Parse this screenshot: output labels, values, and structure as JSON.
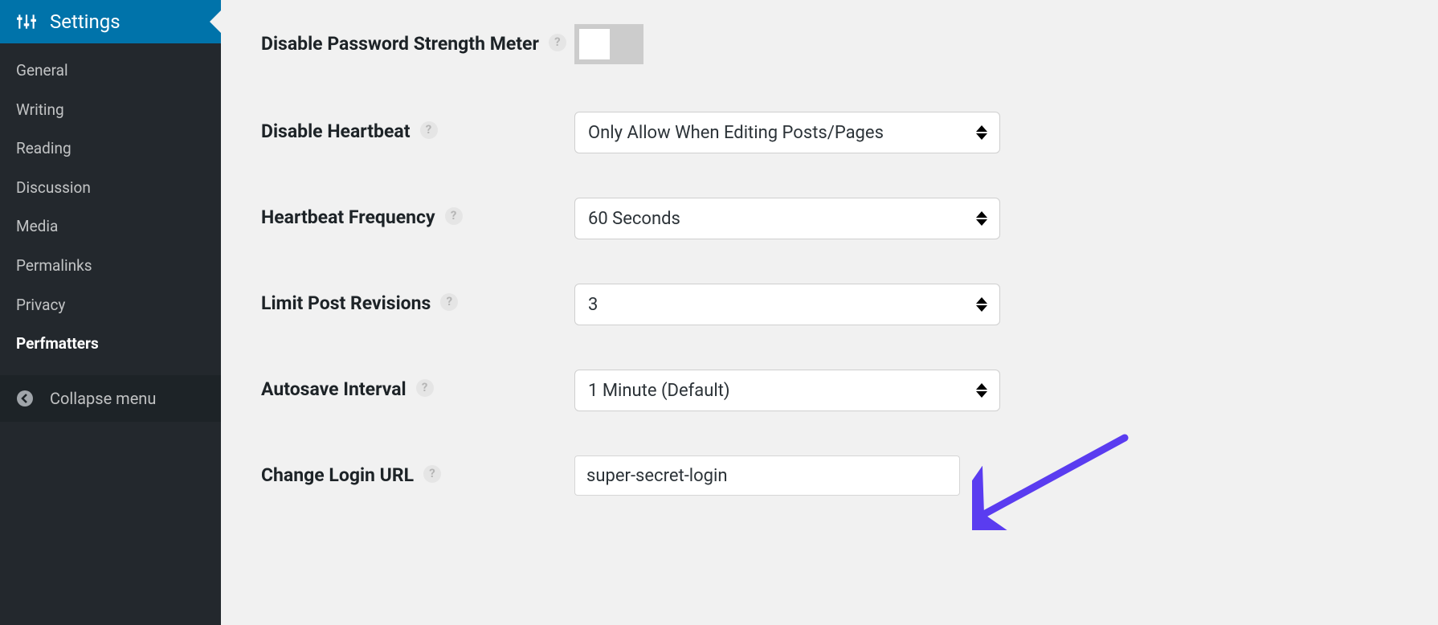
{
  "sidebar": {
    "header": {
      "label": "Settings"
    },
    "items": [
      {
        "label": "General",
        "active": false
      },
      {
        "label": "Writing",
        "active": false
      },
      {
        "label": "Reading",
        "active": false
      },
      {
        "label": "Discussion",
        "active": false
      },
      {
        "label": "Media",
        "active": false
      },
      {
        "label": "Permalinks",
        "active": false
      },
      {
        "label": "Privacy",
        "active": false
      },
      {
        "label": "Perfmatters",
        "active": true
      }
    ],
    "collapse_label": "Collapse menu"
  },
  "settings": {
    "disable_password_strength": {
      "label": "Disable Password Strength Meter",
      "value": false
    },
    "disable_heartbeat": {
      "label": "Disable Heartbeat",
      "value": "Only Allow When Editing Posts/Pages"
    },
    "heartbeat_frequency": {
      "label": "Heartbeat Frequency",
      "value": "60 Seconds"
    },
    "limit_post_revisions": {
      "label": "Limit Post Revisions",
      "value": "3"
    },
    "autosave_interval": {
      "label": "Autosave Interval",
      "value": "1 Minute (Default)"
    },
    "change_login_url": {
      "label": "Change Login URL",
      "value": "super-secret-login"
    }
  },
  "ui": {
    "help_glyph": "?"
  }
}
